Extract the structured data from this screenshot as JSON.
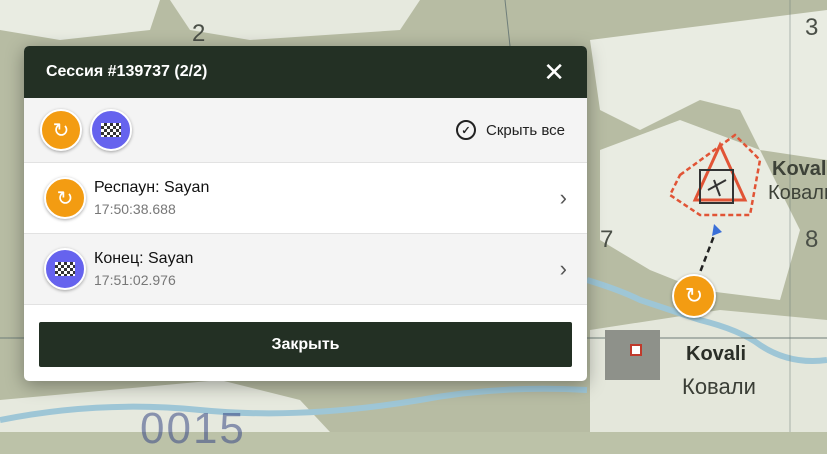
{
  "dialog": {
    "title": "Сессия #139737 (2/2)",
    "close_icon": "close-icon",
    "toolbar": {
      "filters": [
        {
          "icon": "respawn-icon",
          "color": "#f39c12"
        },
        {
          "icon": "finish-flag-icon",
          "color": "#6663ee"
        }
      ],
      "hide_all_label": "Скрыть все"
    },
    "events": [
      {
        "title": "Респаун: Sayan",
        "time": "17:50:38.688",
        "icon": "respawn-icon",
        "color": "#f39c12"
      },
      {
        "title": "Конец: Sayan",
        "time": "17:51:02.976",
        "icon": "finish-flag-icon",
        "color": "#6663ee"
      }
    ],
    "close_button_label": "Закрыть"
  },
  "map": {
    "grid_numbers": [
      "2",
      "3",
      "7",
      "8"
    ],
    "town_label_en": "Kovali",
    "town_label_ru": "Ковали",
    "town_label_en_top": "Kovali",
    "town_label_ru_top": "Ковали",
    "grid_code": "0015",
    "marker_icon": "respawn-icon"
  }
}
